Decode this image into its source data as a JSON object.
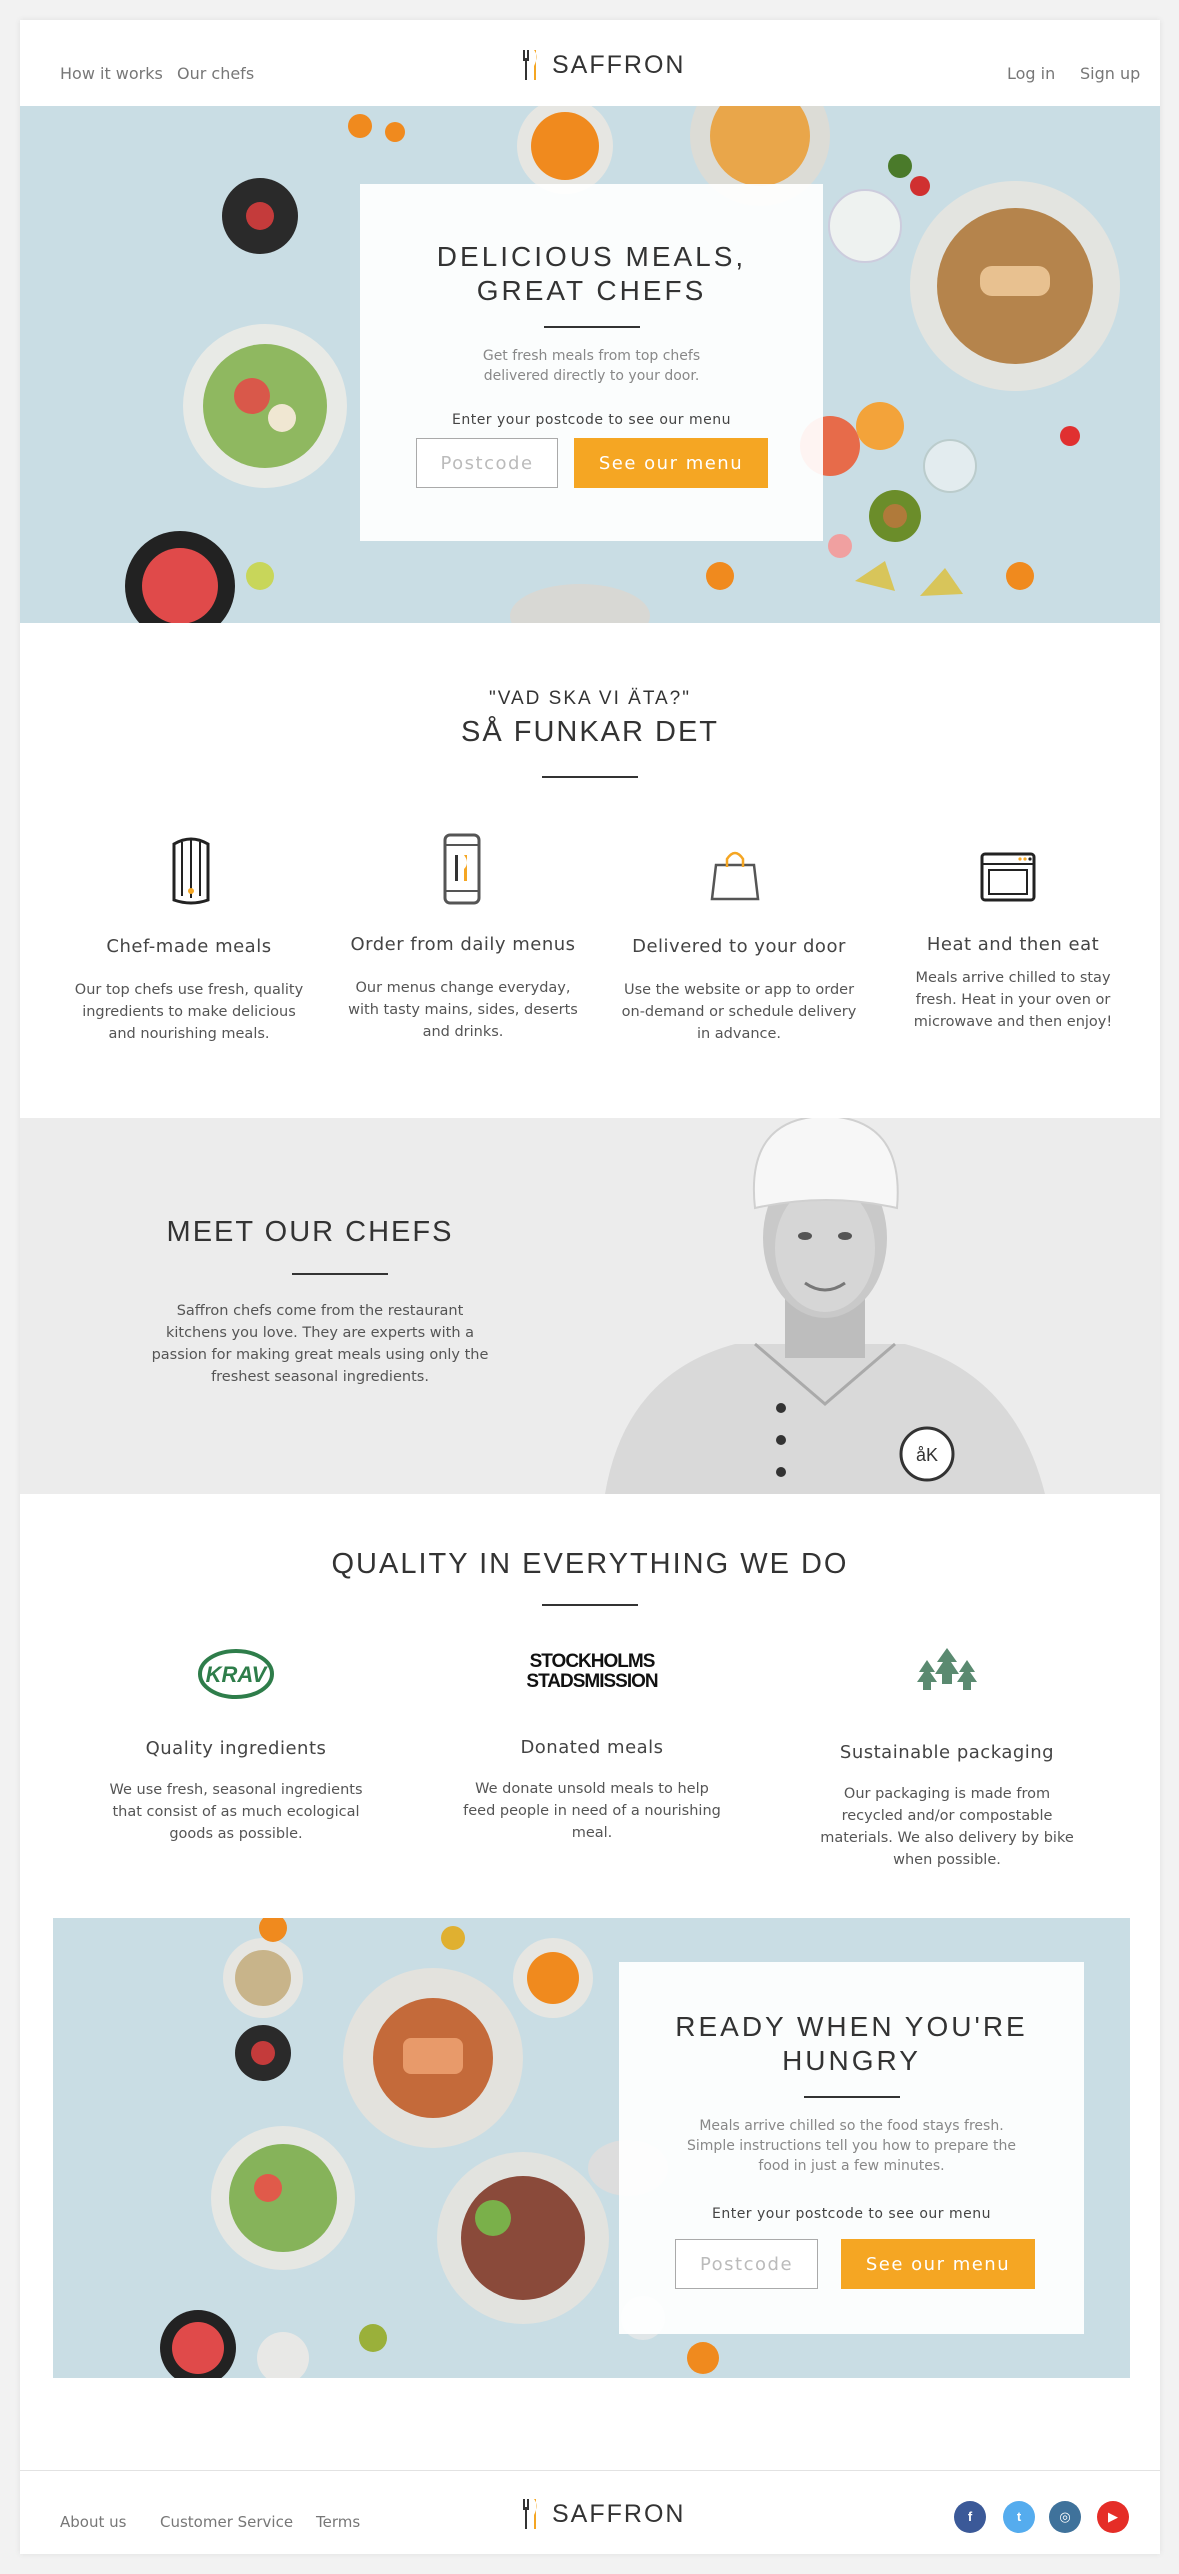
{
  "header": {
    "nav_left": [
      "How it works",
      "Our chefs"
    ],
    "brand": "SAFFRON",
    "login": "Log in",
    "signup": "Sign up"
  },
  "hero": {
    "title_line1": "DELICIOUS MEALS,",
    "title_line2": "GREAT CHEFS",
    "subtitle_line1": "Get fresh meals from top chefs",
    "subtitle_line2": "delivered directly to your door.",
    "postcode_label": "Enter your postcode to see our menu",
    "postcode_placeholder": "Postcode",
    "cta": "See our menu"
  },
  "how_it_works": {
    "kicker": "\"VAD SKA VI ÄTA?\"",
    "title": "SÅ FUNKAR DET",
    "steps": [
      {
        "icon": "chef-hat-icon",
        "title": "Chef-made meals",
        "lines": [
          "Our top chefs use fresh, quality",
          "ingredients to make delicious",
          "and nourishing meals."
        ]
      },
      {
        "icon": "smartphone-icon",
        "title": "Order from daily menus",
        "lines": [
          "Our menus change everyday,",
          "with tasty mains, sides, deserts",
          "and drinks."
        ]
      },
      {
        "icon": "shopping-bag-icon",
        "title": "Delivered to your door",
        "lines": [
          "Use the website or app to order",
          "on-demand or schedule delivery",
          "in advance."
        ]
      },
      {
        "icon": "oven-icon",
        "title": "Heat and then eat",
        "lines": [
          "Meals arrive chilled to stay",
          "fresh. Heat in your oven or",
          "microwave and then enjoy!"
        ]
      }
    ]
  },
  "chefs": {
    "title": "MEET OUR CHEFS",
    "lines": [
      "Saffron chefs come from the restaurant",
      "kitchens you love. They are experts with a",
      "passion for making great meals using only the",
      "freshest seasonal ingredients."
    ],
    "badge_text": "åK"
  },
  "quality": {
    "title": "QUALITY IN EVERYTHING WE DO",
    "items": [
      {
        "logo": "KRAV",
        "title": "Quality ingredients",
        "lines": [
          "We use fresh, seasonal ingredients",
          "that consist of as much ecological",
          "goods as possible."
        ]
      },
      {
        "logo_line1": "STOCKHOLMS",
        "logo_line2": "STADSMISSION",
        "title": "Donated meals",
        "lines": [
          "We donate unsold meals to help",
          "feed people in need of a nourishing",
          "meal."
        ]
      },
      {
        "logo": "trees-icon",
        "title": "Sustainable packaging",
        "lines": [
          "Our packaging is made from",
          "recycled and/or compostable",
          "materials. We also delivery by bike",
          "when possible."
        ]
      }
    ]
  },
  "cta_banner": {
    "title_line1": "READY WHEN YOU'RE",
    "title_line2": "HUNGRY",
    "lines": [
      "Meals arrive chilled so the food stays fresh.",
      "Simple instructions tell you how to prepare the",
      "food in just a few minutes."
    ],
    "postcode_label": "Enter your postcode to see our menu",
    "postcode_placeholder": "Postcode",
    "cta": "See our menu"
  },
  "footer": {
    "links": [
      "About us",
      "Customer Service",
      "Terms"
    ],
    "brand": "SAFFRON",
    "social": [
      {
        "icon": "facebook-icon",
        "glyph": "f",
        "color": "#3b5998"
      },
      {
        "icon": "twitter-icon",
        "glyph": "t",
        "color": "#55acee"
      },
      {
        "icon": "instagram-icon",
        "glyph": "◎",
        "color": "#3f729b"
      },
      {
        "icon": "youtube-icon",
        "glyph": "▶",
        "color": "#e52d27"
      }
    ]
  },
  "colors": {
    "accent": "#f5a623",
    "hero_bg": "#c9dde4",
    "chefs_bg": "#ececec",
    "krav_green": "#2e7d4a",
    "tree_green": "#5a8a70"
  }
}
